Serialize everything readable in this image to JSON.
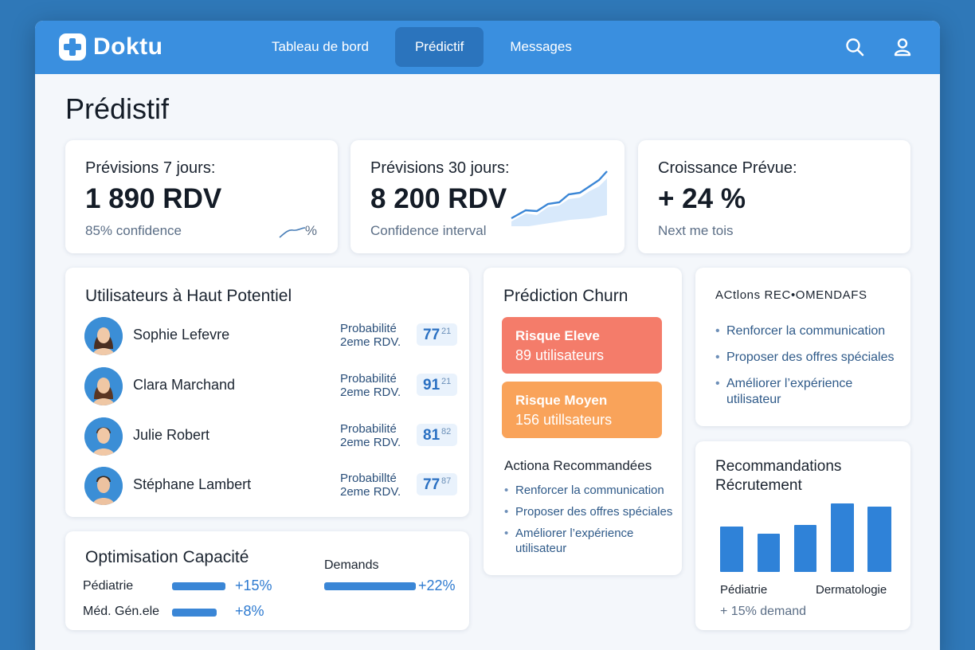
{
  "app": {
    "name": "Doktu"
  },
  "nav": {
    "items": [
      {
        "label": "Tableau de bord",
        "active": false
      },
      {
        "label": "Prédictif",
        "active": true
      },
      {
        "label": "Messages",
        "active": false
      }
    ],
    "icons": [
      "search-icon",
      "user-icon"
    ]
  },
  "page": {
    "title": "Prédistif"
  },
  "kpis": [
    {
      "label": "Prévisions 7 jours:",
      "value": "1 890 RDV",
      "sub": "85% confidence",
      "extra": "%"
    },
    {
      "label": "Prévisions 30 jours:",
      "value": "8 200 RDV",
      "sub": "Confidence interval"
    },
    {
      "label": "Croissance Prévue:",
      "value": "+ 24 %",
      "sub": "Next me tois"
    }
  ],
  "high_potential": {
    "title": "Utilisateurs  à Haut Potentiel",
    "prob_label_line1": "Probabilité",
    "prob_label_line2": "2eme RDV.",
    "users": [
      {
        "name": "Sophie Lefevre",
        "prob_line1": "Probabilité",
        "prob_line2": "2eme RDV.",
        "score": "77",
        "small": "21"
      },
      {
        "name": "Clara Marchand",
        "prob_line1": "Probabilité",
        "prob_line2": "2eme RDV.",
        "score": "91",
        "small": "21"
      },
      {
        "name": "Julie Robert",
        "prob_line1": "Probabilité",
        "prob_line2": "2eme RDV.",
        "score": "81",
        "small": "82"
      },
      {
        "name": "Stéphane Lambert",
        "prob_line1": "Probabillté",
        "prob_line2": "2eme RDV.",
        "score": "77",
        "small": "87"
      }
    ]
  },
  "churn": {
    "title": "Prédiction  Churn",
    "high": {
      "title": "Risque Eleve",
      "sub": "89 utilisateurs",
      "color": "#f47c6a"
    },
    "medium": {
      "title": "Risque Moyen",
      "sub": "156 utillsateurs",
      "color": "#f9a35a"
    },
    "actions_title": "Actiona Recommandées",
    "actions": [
      "Renforcer la communication",
      "Proposer des offres spéciales",
      "Améliorer l’expérience utilisateur"
    ]
  },
  "actions_card": {
    "title": "ACtlons REC•OMENDAFS",
    "items": [
      "Renforcer la communication",
      "Proposer des offres spéciales",
      "Améliorer l’expérience utilisateur"
    ]
  },
  "capacity": {
    "title": "Optimisation Capacité",
    "demands_label": "Demands",
    "rows": [
      {
        "label": "Pédiatrie",
        "value": "+15%"
      },
      {
        "label": "Méd. Gén.ele",
        "value": "+8%"
      }
    ],
    "demands_value": "+22%"
  },
  "recruitment": {
    "title_line1": "Recommandations",
    "title_line2": "Récrutement",
    "label_left": "Pédiatrie",
    "label_right": "Dermatologie",
    "footer": "+ 15% demand"
  },
  "colors": {
    "accent": "#3a8fdf",
    "nav_active": "#2b74bd",
    "risk_high": "#f47c6a",
    "risk_medium": "#f9a35a"
  }
}
